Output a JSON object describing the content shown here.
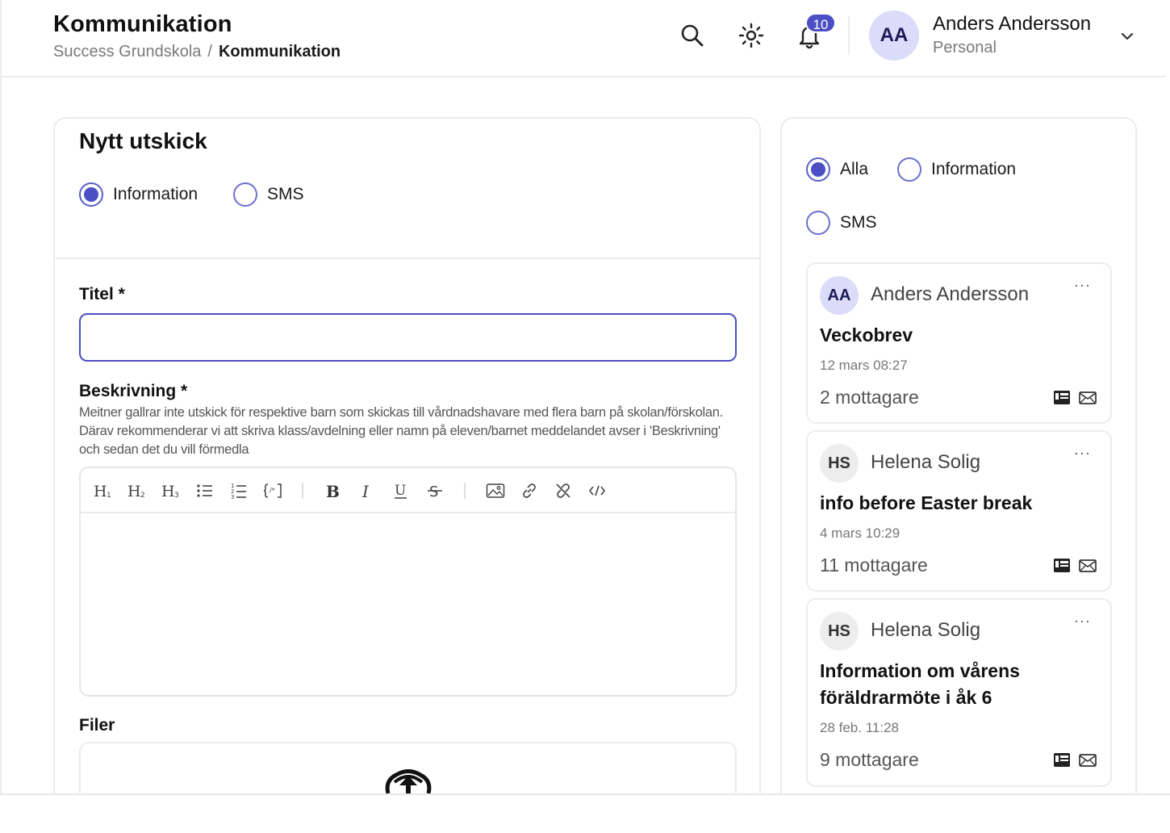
{
  "header": {
    "title": "Kommunikation",
    "breadcrumb": {
      "parent": "Success Grundskola",
      "separator": "/",
      "current": "Kommunikation"
    },
    "icons": [
      "search-icon",
      "sun-icon",
      "bell-icon"
    ],
    "notification_count": "10",
    "user": {
      "initials": "AA",
      "name": "Anders Andersson",
      "role": "Personal"
    }
  },
  "compose": {
    "heading": "Nytt utskick",
    "type_options": [
      {
        "label": "Information",
        "selected": true
      },
      {
        "label": "SMS",
        "selected": false
      }
    ],
    "title_label": "Titel *",
    "title_value": "",
    "description_label": "Beskrivning *",
    "description_help": "Meitner gallrar inte utskick för respektive barn som skickas till vårdnadshavare med flera barn på skolan/förskolan. Därav rekommenderar vi att skriva klass/avdelning eller namn på eleven/barnet meddelandet avser i 'Beskrivning' och sedan det du vill förmedla",
    "toolbar": [
      "heading-1-icon",
      "heading-2-icon",
      "heading-3-icon",
      "bullet-list-icon",
      "ordered-list-icon",
      "code-block-icon",
      "bold-icon",
      "italic-icon",
      "underline-icon",
      "strikethrough-icon",
      "image-icon",
      "link-icon",
      "unlink-icon",
      "code-icon"
    ],
    "files_label": "Filer"
  },
  "filters": [
    {
      "label": "Alla",
      "selected": true
    },
    {
      "label": "Information",
      "selected": false
    },
    {
      "label": "SMS",
      "selected": false
    }
  ],
  "messages": [
    {
      "initials": "AA",
      "author": "Anders Andersson",
      "title": "Veckobrev",
      "date": "12 mars 08:27",
      "recipients": "2 mottagare"
    },
    {
      "initials": "HS",
      "author": "Helena Solig",
      "title": "info before Easter break",
      "date": "4 mars 10:29",
      "recipients": "11 mottagare"
    },
    {
      "initials": "HS",
      "author": "Helena Solig",
      "title": "Information om vårens föräldrarmöte i åk 6",
      "date": "28 feb. 11:28",
      "recipients": "9 mottagare"
    }
  ],
  "colors": {
    "accent": "#4c4fc4",
    "avatar_purple": "#dcdcfa",
    "avatar_gray": "#ededed",
    "border": "#ececec"
  }
}
